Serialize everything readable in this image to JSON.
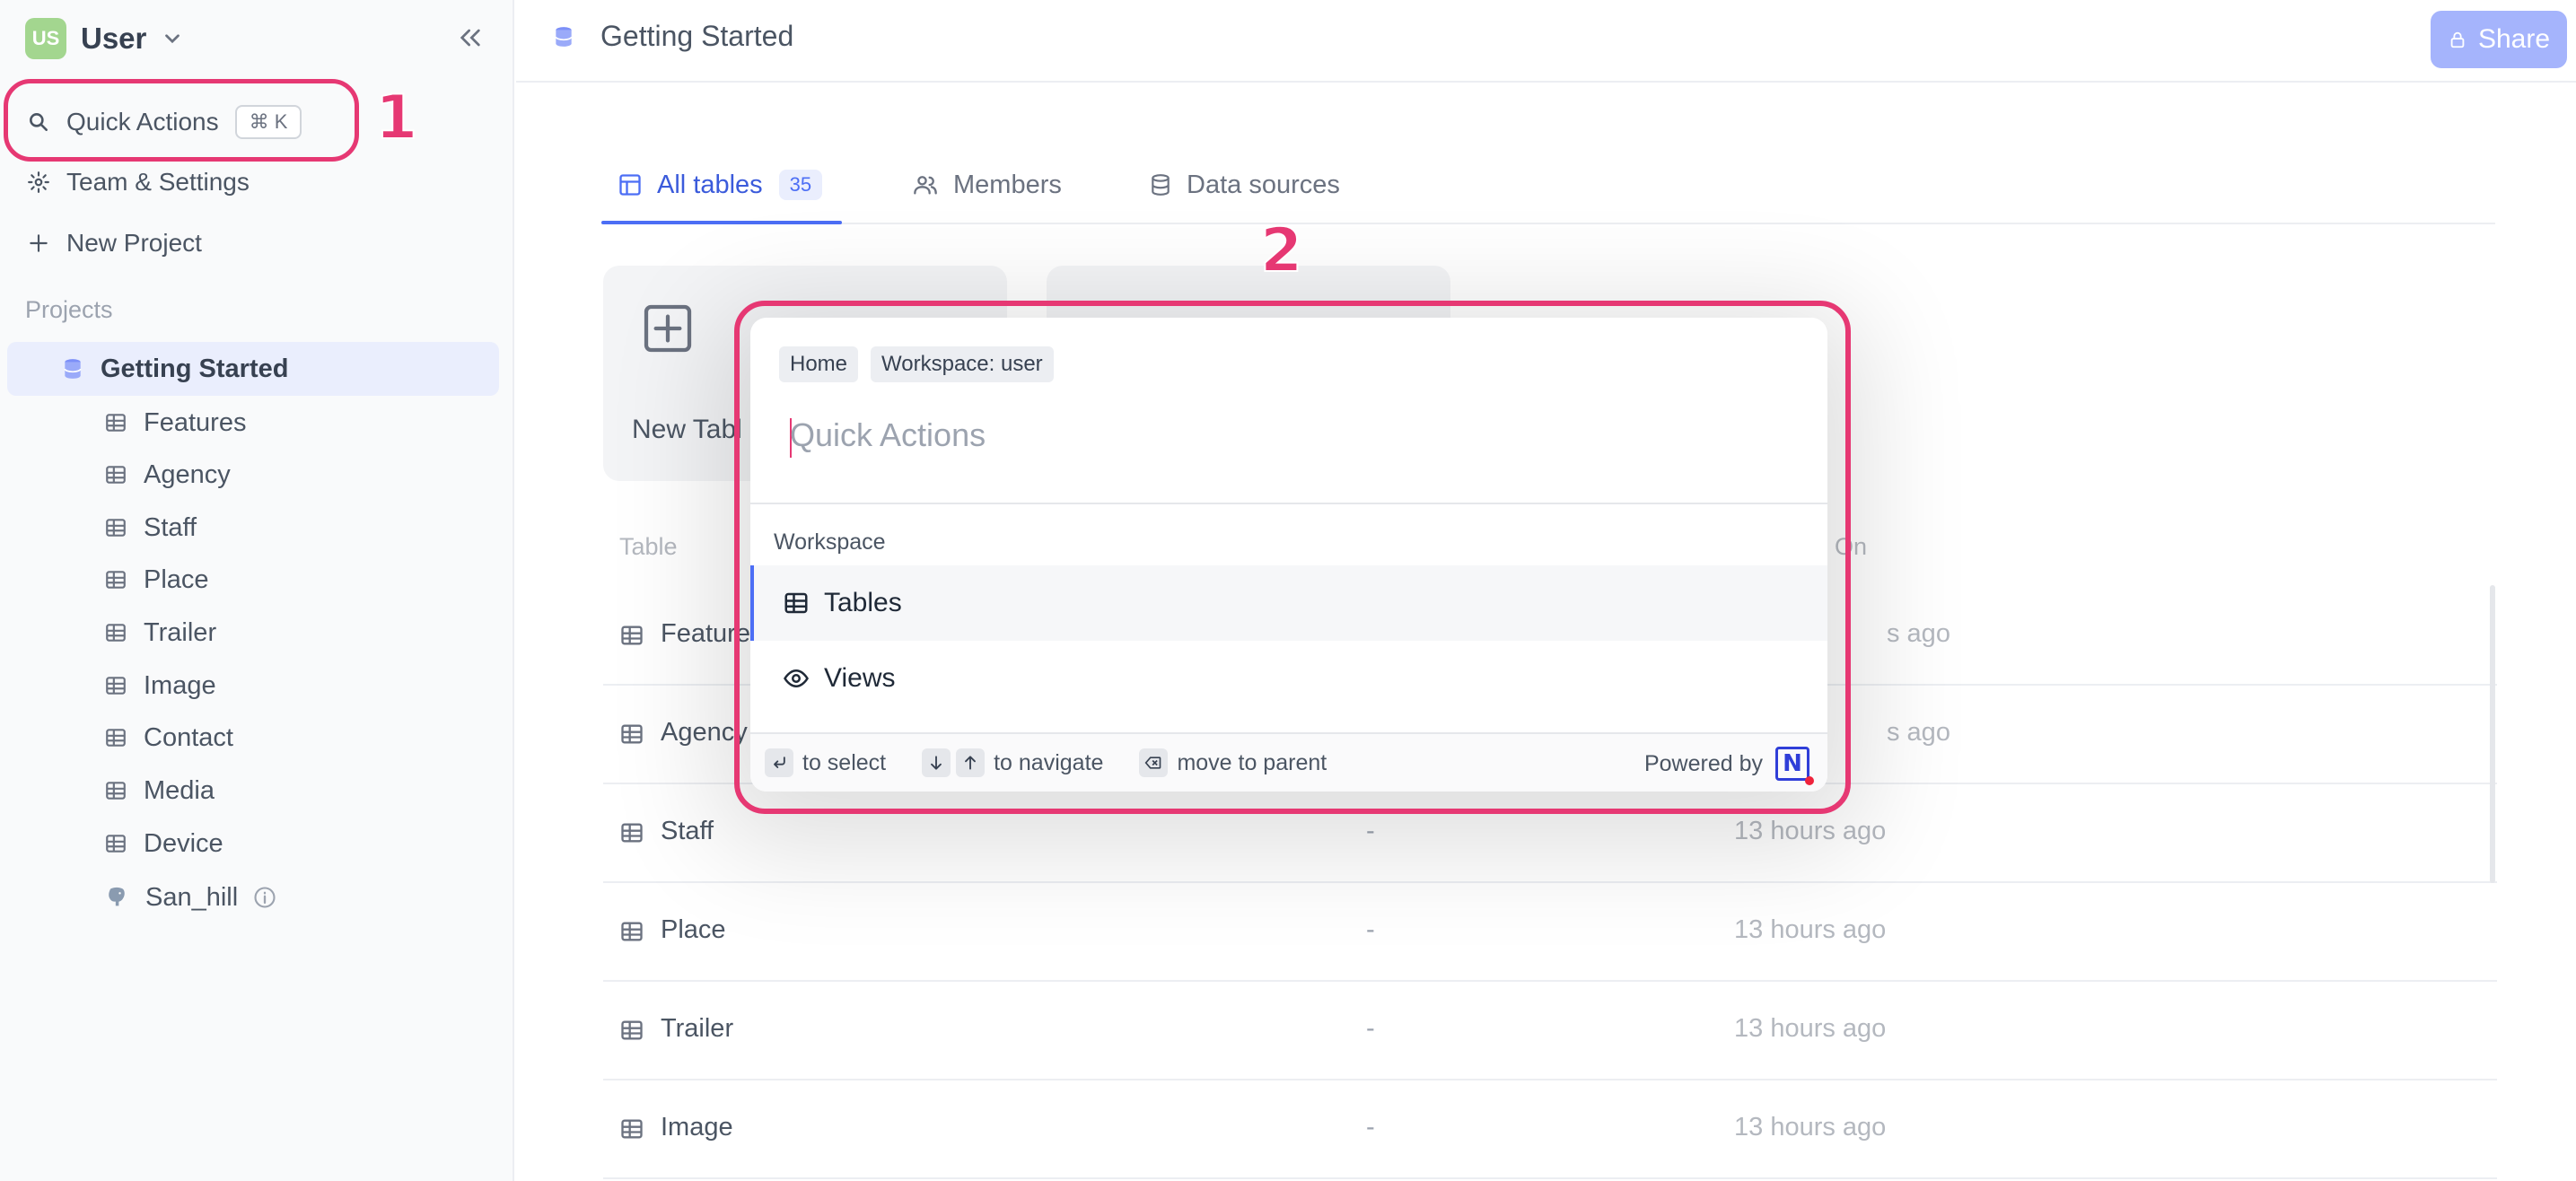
{
  "sidebar": {
    "workspace": {
      "initials": "US",
      "name": "User"
    },
    "quick_actions": {
      "label": "Quick Actions",
      "shortcut": "⌘ K"
    },
    "team_settings": "Team & Settings",
    "new_project": "New Project",
    "projects_label": "Projects",
    "active_project": "Getting Started",
    "tables": [
      "Features",
      "Agency",
      "Staff",
      "Place",
      "Trailer",
      "Image",
      "Contact",
      "Media",
      "Device"
    ],
    "source": "San_hill"
  },
  "topbar": {
    "title": "Getting Started",
    "share_label": "Share"
  },
  "tabs": [
    {
      "label": "All tables",
      "count": "35"
    },
    {
      "label": "Members"
    },
    {
      "label": "Data sources"
    }
  ],
  "cards": {
    "new_table": "New Tabl"
  },
  "table_list": {
    "headers": {
      "table": "Table",
      "on": "On"
    },
    "rows": [
      {
        "name": "Feature",
        "desc": "",
        "time": "s ago"
      },
      {
        "name": "Agency",
        "desc": "",
        "time": "s ago"
      },
      {
        "name": "Staff",
        "desc": "-",
        "time": "13 hours ago"
      },
      {
        "name": "Place",
        "desc": "-",
        "time": "13 hours ago"
      },
      {
        "name": "Trailer",
        "desc": "-",
        "time": "13 hours ago"
      },
      {
        "name": "Image",
        "desc": "-",
        "time": "13 hours ago"
      }
    ]
  },
  "modal": {
    "crumbs": [
      "Home",
      "Workspace: user"
    ],
    "placeholder": "Quick Actions",
    "group_label": "Workspace",
    "options": [
      "Tables",
      "Views"
    ],
    "footer": {
      "select": "to select",
      "navigate": "to navigate",
      "parent": "move to parent",
      "powered_by": "Powered by"
    }
  },
  "annotations": {
    "one": "1",
    "two": "2"
  },
  "colors": {
    "accent": "#4c6ef5",
    "annotation": "#e63873",
    "share": "#a5b4fc"
  }
}
